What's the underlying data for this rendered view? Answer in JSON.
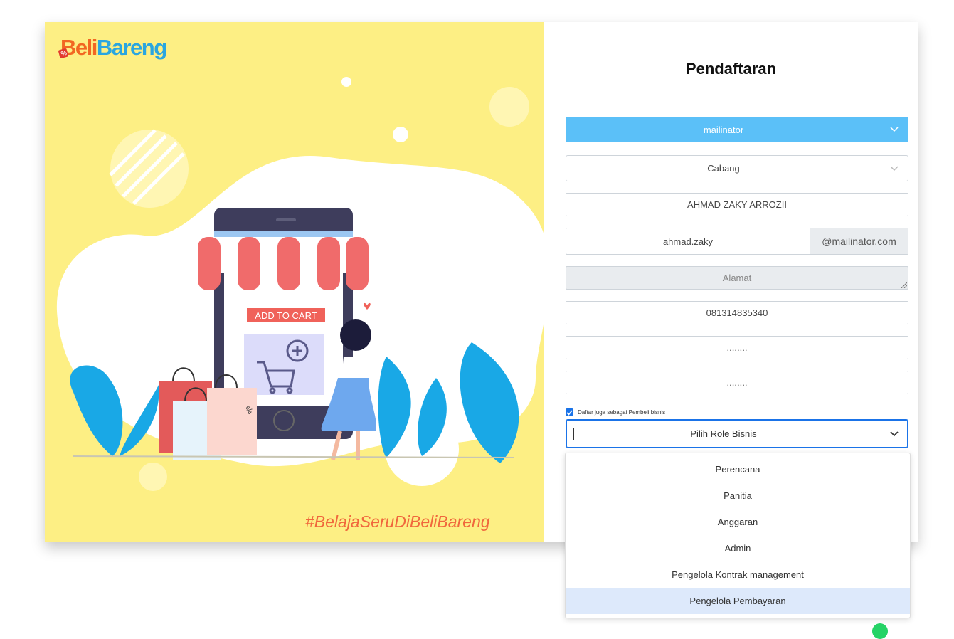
{
  "brand": {
    "logo_beli": "Beli",
    "logo_bareng": "Bareng",
    "tag_symbol": "%"
  },
  "hero": {
    "hashtag": "#BelajaSeruDiBeliBareng",
    "illustration_text": "ADD TO CART",
    "bag_tag": "%"
  },
  "form": {
    "title": "Pendaftaran",
    "company_select": "mailinator",
    "branch_select": "Cabang",
    "full_name": "AHMAD ZAKY ARROZII",
    "email_user": "ahmad.zaky",
    "email_domain": "@mailinator.com",
    "address_placeholder": "Alamat",
    "phone": "081314835340",
    "password": "........",
    "password_confirm": "........",
    "business_checkbox_label": "Daftar juga sebagai Pembeli bisnis",
    "role_select_placeholder": "Pilih Role Bisnis"
  },
  "role_options": [
    "Perencana",
    "Panitia",
    "Anggaran",
    "Admin",
    "Pengelola Kontrak management",
    "Pengelola Pembayaran"
  ],
  "colors": {
    "accent_blue": "#5bc0f8",
    "focus_blue": "#1a73e8",
    "hero_yellow": "#fdef84"
  }
}
